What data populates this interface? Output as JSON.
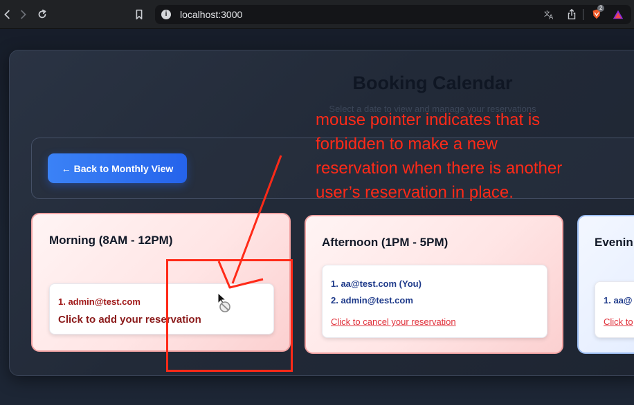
{
  "browser": {
    "url": "localhost:3000",
    "shield_badge": "2"
  },
  "page": {
    "title": "Booking Calendar",
    "subtitle": "Select a date to view and manage your reservations",
    "back_button": "← Back to Monthly View"
  },
  "slots": [
    {
      "title": "Morning (8AM - 12PM)",
      "reservations": [
        "1. admin@test.com"
      ],
      "action": "Click to add your reservation",
      "accent": "#f2a3a3"
    },
    {
      "title": "Afternoon (1PM - 5PM)",
      "reservations": [
        "1. aa@test.com (You)",
        "2. admin@test.com"
      ],
      "action": "Click to cancel your reservation",
      "accent": "#f2a3a3"
    },
    {
      "title": "Evenin",
      "reservations": [
        "1. aa@"
      ],
      "action": "Click to",
      "accent": "#9dbef2"
    }
  ],
  "annotation": {
    "text": "mouse pointer  indicates that is\nforbidden to make a new\nreservation when there is another\nuser’s reservation in place.",
    "color": "#ff2a18"
  }
}
